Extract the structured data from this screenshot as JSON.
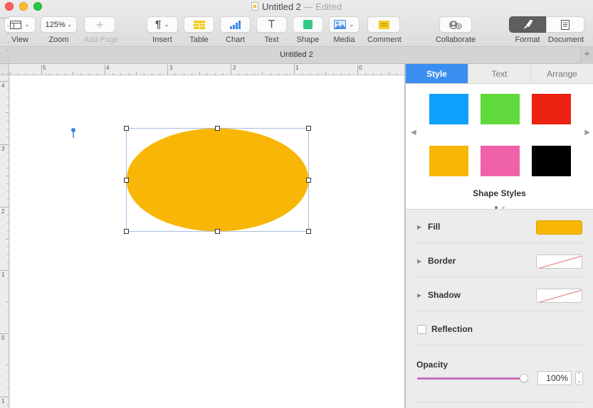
{
  "window": {
    "title": "Untitled 2",
    "title_suffix": "— Edited"
  },
  "toolbar": {
    "view_label": "View",
    "zoom_value": "125%",
    "zoom_label": "Zoom",
    "add_page_label": "Add Page",
    "insert_label": "Insert",
    "table_label": "Table",
    "chart_label": "Chart",
    "text_label": "Text",
    "shape_label": "Shape",
    "media_label": "Media",
    "comment_label": "Comment",
    "collaborate_label": "Collaborate",
    "format_label": "Format",
    "document_label": "Document"
  },
  "tabbar": {
    "tab_title": "Untitled 2",
    "add_tab": "+"
  },
  "rulers": {
    "horizontal": [
      "5",
      "4",
      "3",
      "2",
      "1",
      "0"
    ],
    "vertical": [
      "4",
      "3",
      "2",
      "1",
      "0",
      "1"
    ]
  },
  "canvas": {
    "shape": {
      "type": "ellipse",
      "fill": "#f8b707",
      "selected": true
    }
  },
  "inspector": {
    "tabs": [
      {
        "label": "Style",
        "active": true
      },
      {
        "label": "Text",
        "active": false
      },
      {
        "label": "Arrange",
        "active": false
      }
    ],
    "shape_styles": {
      "label": "Shape Styles",
      "swatches": [
        "#0ea0fb",
        "#5fd93b",
        "#ee2212",
        "#f8b707",
        "#ef61a8",
        "#000000"
      ],
      "page": 1,
      "pages": 2
    },
    "fill": {
      "label": "Fill",
      "color": "#f8b707"
    },
    "border": {
      "label": "Border",
      "value": "none"
    },
    "shadow": {
      "label": "Shadow",
      "value": "none"
    },
    "reflection": {
      "label": "Reflection",
      "checked": false
    },
    "opacity": {
      "label": "Opacity",
      "value_text": "100%",
      "value": 1.0
    },
    "accent": "#3b8ff0"
  }
}
